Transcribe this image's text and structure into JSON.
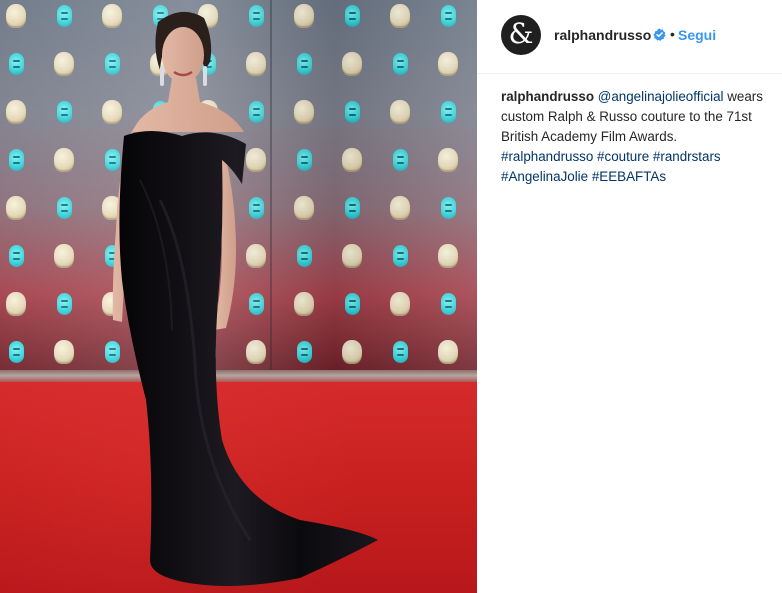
{
  "photo": {
    "icon": "photo-red-carpet",
    "colors": {
      "carpet": "#c8201f",
      "backdrop_logo_teal": "#2fd0d8",
      "dress": "#0b0a0c"
    }
  },
  "post": {
    "account": {
      "avatar_glyph": "&",
      "username": "ralphandrusso",
      "verified_icon": "verified-badge-icon",
      "separator": "•",
      "follow_label": "Segui"
    },
    "caption": {
      "author": "ralphandrusso",
      "mention": "@angelinajolieofficial",
      "text_line1_rest": " wears custom Ralph & Russo couture to the 71st British Academy Film Awards.",
      "hashtags": [
        "#ralphandrusso",
        "#couture",
        "#randrstars",
        "#AngelinaJolie",
        "#EEBAFTAs"
      ]
    }
  },
  "colors": {
    "link_blue": "#3897f0",
    "hashtag_blue": "#003569",
    "text": "#262626"
  }
}
